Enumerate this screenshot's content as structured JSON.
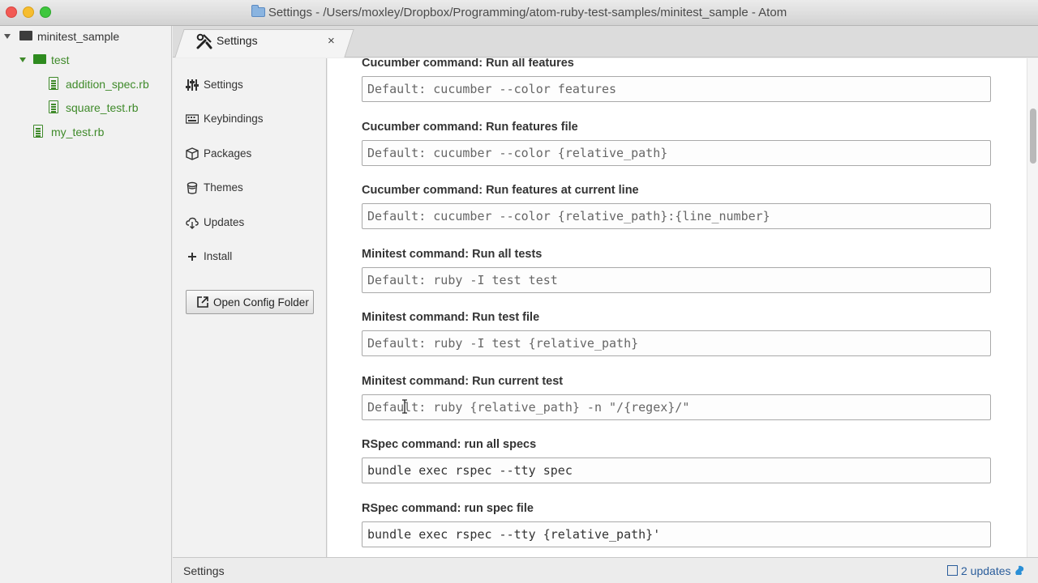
{
  "window": {
    "title": "Settings - /Users/moxley/Dropbox/Programming/atom-ruby-test-samples/minitest_sample - Atom"
  },
  "tree": {
    "items": [
      {
        "label": "minitest_sample",
        "kind": "folder"
      },
      {
        "label": "test",
        "kind": "folder"
      },
      {
        "label": "addition_spec.rb",
        "kind": "file"
      },
      {
        "label": "square_test.rb",
        "kind": "file"
      },
      {
        "label": "my_test.rb",
        "kind": "file"
      }
    ]
  },
  "tabs": [
    {
      "label": "Settings",
      "icon": "tools-icon",
      "close": "×"
    }
  ],
  "nav": {
    "items": [
      {
        "label": "Settings",
        "icon": "sliders-icon"
      },
      {
        "label": "Keybindings",
        "icon": "keyboard-icon"
      },
      {
        "label": "Packages",
        "icon": "package-icon"
      },
      {
        "label": "Themes",
        "icon": "paintcan-icon"
      },
      {
        "label": "Updates",
        "icon": "cloud-download-icon"
      },
      {
        "label": "Install",
        "icon": "plus-icon"
      }
    ],
    "open_config_label": "Open Config Folder"
  },
  "settings": [
    {
      "label": "Cucumber command: Run all features",
      "value": "",
      "placeholder": "Default: cucumber --color features"
    },
    {
      "label": "Cucumber command: Run features file",
      "value": "",
      "placeholder": "Default: cucumber --color {relative_path}"
    },
    {
      "label": "Cucumber command: Run features at current line",
      "value": "",
      "placeholder": "Default: cucumber --color {relative_path}:{line_number}"
    },
    {
      "label": "Minitest command: Run all tests",
      "value": "",
      "placeholder": "Default: ruby -I test test"
    },
    {
      "label": "Minitest command: Run test file",
      "value": "",
      "placeholder": "Default: ruby -I test {relative_path}"
    },
    {
      "label": "Minitest command: Run current test",
      "value": "",
      "placeholder": "Default: ruby {relative_path} -n \"/{regex}/\""
    },
    {
      "label": "RSpec command: run all specs",
      "value": "bundle exec rspec --tty spec",
      "placeholder": ""
    },
    {
      "label": "RSpec command: run spec file",
      "value": "bundle exec rspec --tty {relative_path}'",
      "placeholder": ""
    }
  ],
  "status": {
    "left": "Settings",
    "updates": "2 updates"
  },
  "colors": {
    "accent_green": "#3f8a2a",
    "link_blue": "#2a5d9b"
  }
}
